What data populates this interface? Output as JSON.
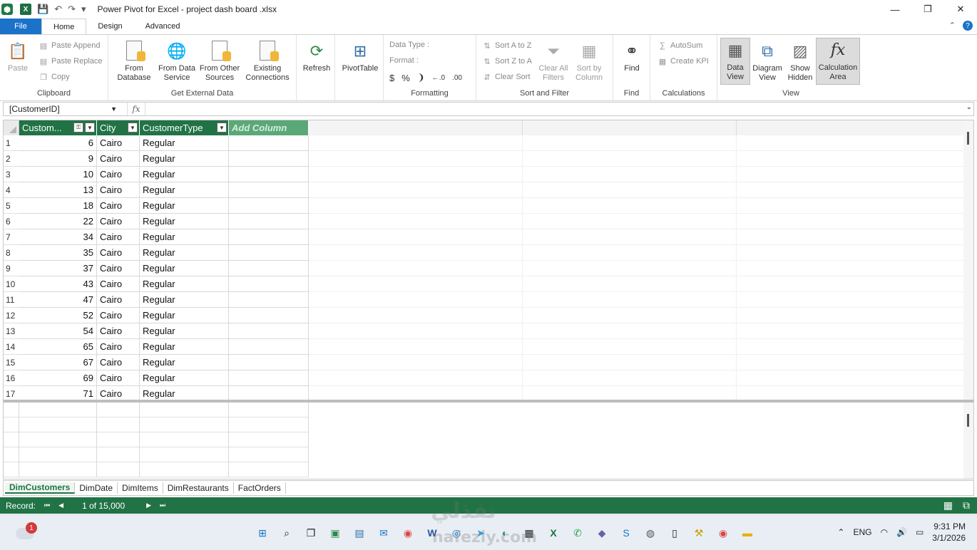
{
  "window": {
    "title": "Power Pivot for Excel - project dash board .xlsx",
    "minimize": "—",
    "maximize": "❐",
    "close": "✕"
  },
  "ribbon_tabs": [
    "File",
    "Home",
    "Design",
    "Advanced"
  ],
  "ribbon": {
    "clipboard": {
      "label": "Clipboard",
      "paste": "Paste",
      "paste_append": "Paste Append",
      "paste_replace": "Paste Replace",
      "copy": "Copy"
    },
    "get_external_data": {
      "label": "Get External Data",
      "from_database": "From Database",
      "from_data_service": "From Data Service",
      "from_other_sources": "From Other Sources",
      "existing_connections": "Existing Connections"
    },
    "refresh": "Refresh",
    "pivottable": "PivotTable",
    "formatting": {
      "label": "Formatting",
      "data_type": "Data Type :",
      "format": "Format :",
      "currency": "$",
      "percent": "%",
      "comma": "❩",
      "inc_decimal": "←.0",
      "dec_decimal": ".00"
    },
    "sort_filter": {
      "label": "Sort and Filter",
      "sort_az": "Sort A to Z",
      "sort_za": "Sort Z to A",
      "clear_sort": "Clear Sort",
      "clear_all_filters": "Clear All Filters",
      "sort_by_column": "Sort by Column"
    },
    "find": {
      "label": "Find",
      "button": "Find"
    },
    "calculations": {
      "label": "Calculations",
      "autosum": "AutoSum",
      "create_kpi": "Create KPI"
    },
    "view": {
      "label": "View",
      "data_view": "Data View",
      "diagram_view": "Diagram View",
      "show_hidden": "Show Hidden",
      "calculation_area": "Calculation Area"
    }
  },
  "formula_bar": {
    "name_box": "[CustomerID]",
    "fx": "fx",
    "formula": ""
  },
  "table": {
    "columns": [
      "Custom...",
      "City",
      "CustomerType",
      "Add Column"
    ],
    "rows": [
      {
        "n": "1",
        "id": "6",
        "city": "Cairo",
        "type": "Regular"
      },
      {
        "n": "2",
        "id": "9",
        "city": "Cairo",
        "type": "Regular"
      },
      {
        "n": "3",
        "id": "10",
        "city": "Cairo",
        "type": "Regular"
      },
      {
        "n": "4",
        "id": "13",
        "city": "Cairo",
        "type": "Regular"
      },
      {
        "n": "5",
        "id": "18",
        "city": "Cairo",
        "type": "Regular"
      },
      {
        "n": "6",
        "id": "22",
        "city": "Cairo",
        "type": "Regular"
      },
      {
        "n": "7",
        "id": "34",
        "city": "Cairo",
        "type": "Regular"
      },
      {
        "n": "8",
        "id": "35",
        "city": "Cairo",
        "type": "Regular"
      },
      {
        "n": "9",
        "id": "37",
        "city": "Cairo",
        "type": "Regular"
      },
      {
        "n": "10",
        "id": "43",
        "city": "Cairo",
        "type": "Regular"
      },
      {
        "n": "11",
        "id": "47",
        "city": "Cairo",
        "type": "Regular"
      },
      {
        "n": "12",
        "id": "52",
        "city": "Cairo",
        "type": "Regular"
      },
      {
        "n": "13",
        "id": "54",
        "city": "Cairo",
        "type": "Regular"
      },
      {
        "n": "14",
        "id": "65",
        "city": "Cairo",
        "type": "Regular"
      },
      {
        "n": "15",
        "id": "67",
        "city": "Cairo",
        "type": "Regular"
      },
      {
        "n": "16",
        "id": "69",
        "city": "Cairo",
        "type": "Regular"
      },
      {
        "n": "17",
        "id": "71",
        "city": "Cairo",
        "type": "Regular"
      }
    ]
  },
  "sheet_tabs": [
    "DimCustomers",
    "DimDate",
    "DimItems",
    "DimRestaurants",
    "FactOrders"
  ],
  "status": {
    "record_label": "Record:",
    "record": "1 of 15,000"
  },
  "taskbar": {
    "notification_count": "1",
    "language": "ENG",
    "time": "9:31 PM",
    "date": "3/1/2026"
  },
  "watermark": {
    "arabic": "نفذلي",
    "latin": "nafezly.com"
  }
}
